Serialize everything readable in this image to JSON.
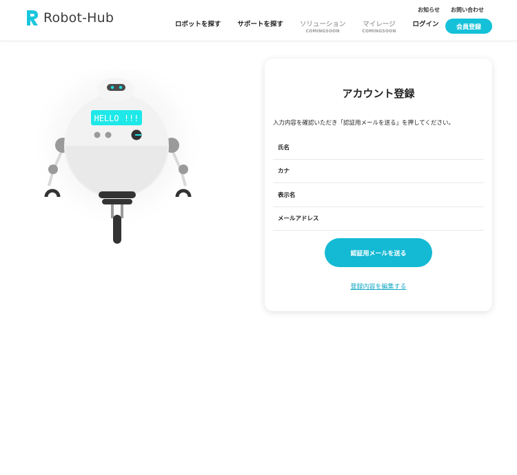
{
  "header": {
    "logo_text": "Robot-Hub",
    "top_links": [
      "お知らせ",
      "お問い合わせ"
    ],
    "nav": [
      {
        "label": "ロボットを探す",
        "sub": ""
      },
      {
        "label": "サポートを探す",
        "sub": ""
      },
      {
        "label": "ソリューション",
        "sub": "COMINGSOON"
      },
      {
        "label": "マイレージ",
        "sub": "COMINGSOON"
      },
      {
        "label": "ログイン",
        "sub": ""
      }
    ],
    "register_label": "会員登録"
  },
  "robot": {
    "screen_text": "HELLO !!!"
  },
  "form": {
    "title": "アカウント登録",
    "description": "入力内容を確認いただき「認証用メールを送る」を押してください。",
    "fields": [
      "氏名",
      "カナ",
      "表示名",
      "メールアドレス"
    ],
    "send_label": "認証用メールを送る",
    "edit_label": "登録内容を編集する"
  },
  "colors": {
    "accent": "#14c1d8",
    "link": "#14a9c4"
  }
}
